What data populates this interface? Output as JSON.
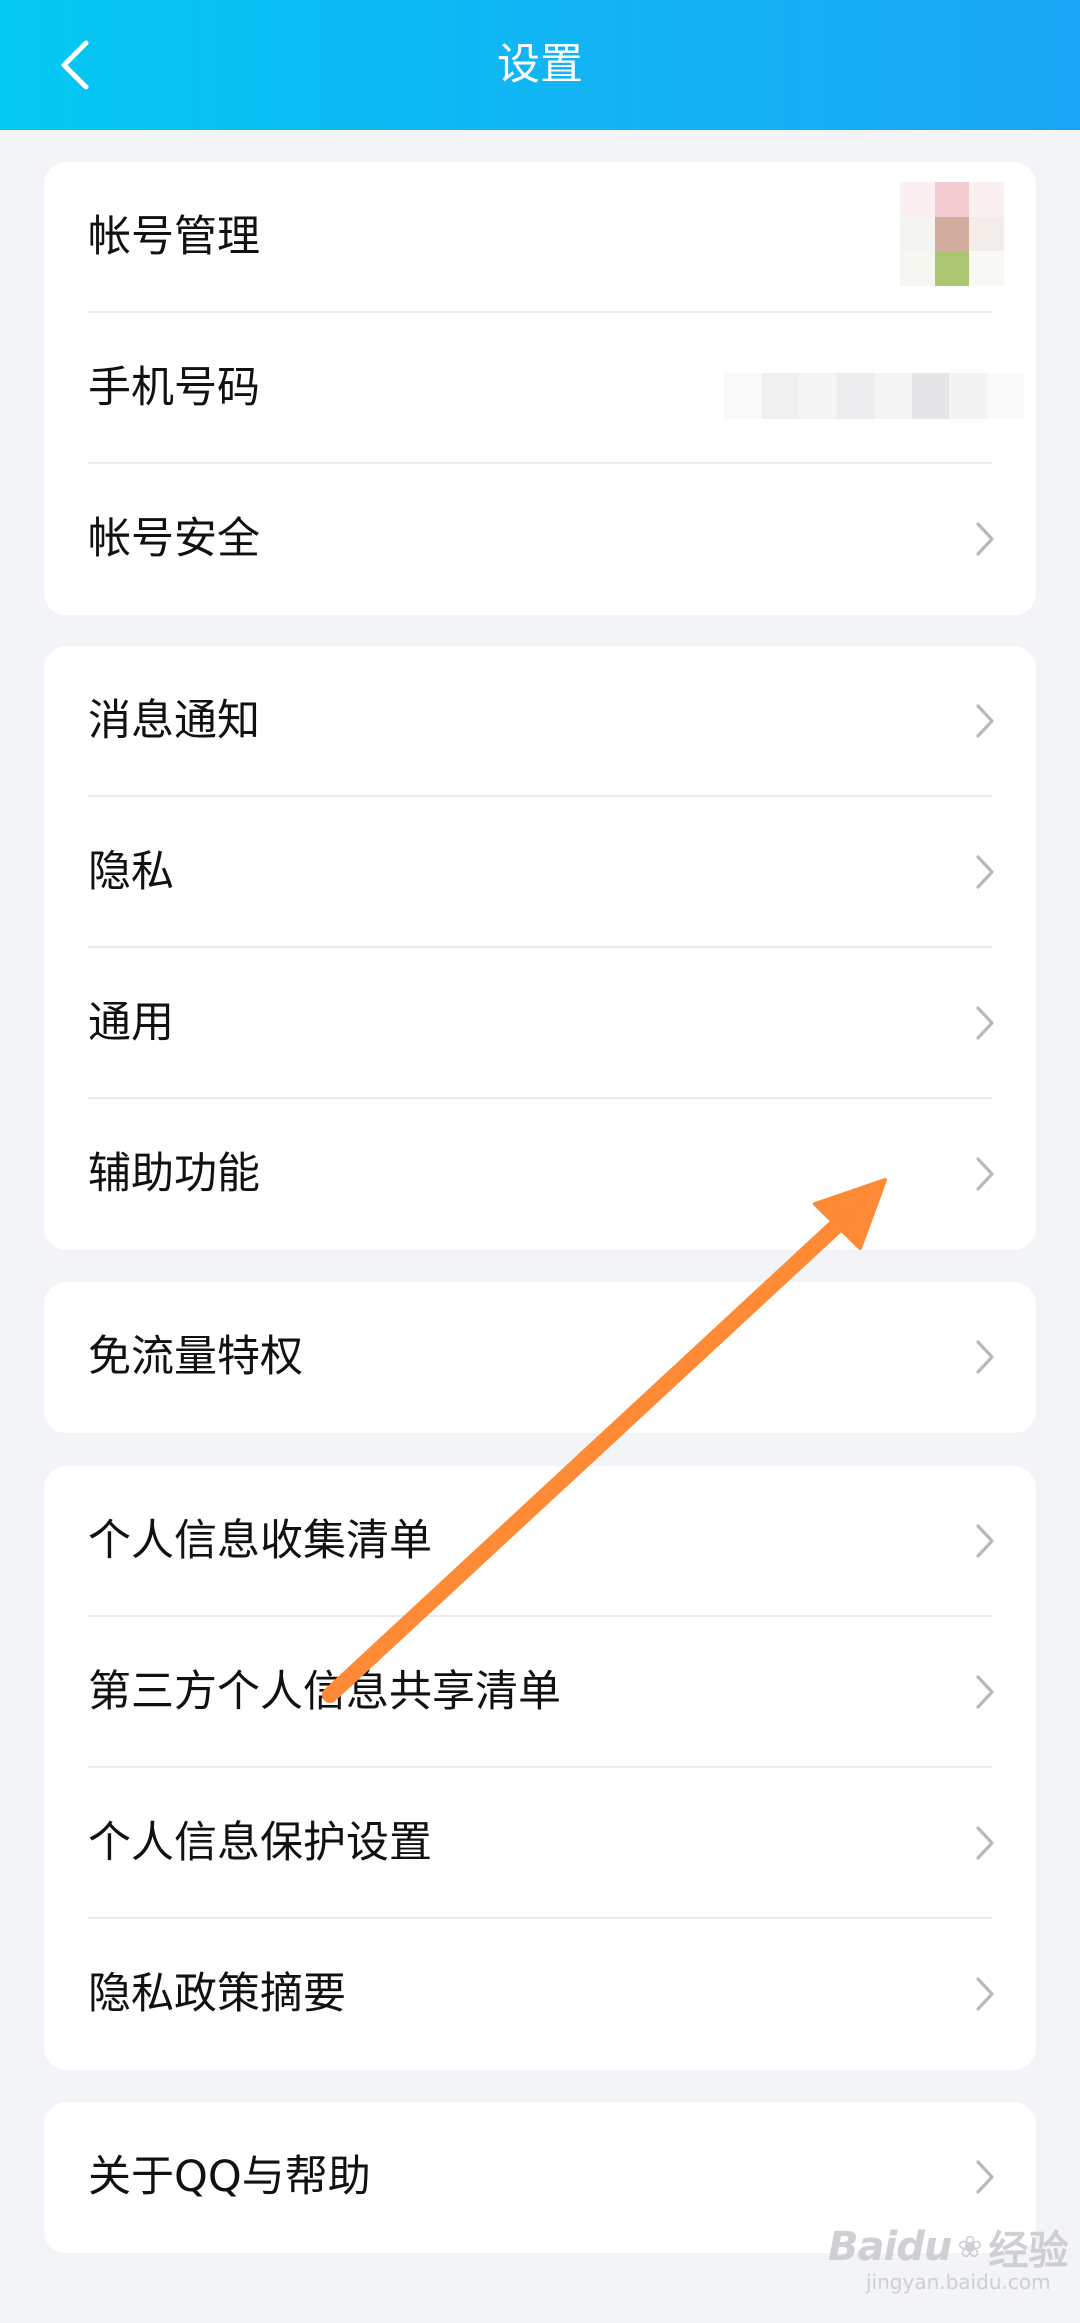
{
  "header": {
    "title": "设置",
    "back_icon": "chevron-left-icon"
  },
  "groups": [
    {
      "items": [
        {
          "label": "帐号管理",
          "chevron": false,
          "extra": "avatar"
        },
        {
          "label": "手机号码",
          "chevron": false,
          "extra": "phone-value"
        },
        {
          "label": "帐号安全",
          "chevron": true
        }
      ]
    },
    {
      "items": [
        {
          "label": "消息通知",
          "chevron": true
        },
        {
          "label": "隐私",
          "chevron": true
        },
        {
          "label": "通用",
          "chevron": true
        },
        {
          "label": "辅助功能",
          "chevron": true
        }
      ]
    },
    {
      "items": [
        {
          "label": "免流量特权",
          "chevron": true
        }
      ]
    },
    {
      "items": [
        {
          "label": "个人信息收集清单",
          "chevron": true
        },
        {
          "label": "第三方个人信息共享清单",
          "chevron": true
        },
        {
          "label": "个人信息保护设置",
          "chevron": true
        },
        {
          "label": "隐私政策摘要",
          "chevron": true
        }
      ]
    },
    {
      "items": [
        {
          "label": "关于QQ与帮助",
          "chevron": true
        }
      ]
    }
  ],
  "watermark": {
    "brand": "Baidu",
    "suffix": "经验",
    "url": "jingyan.baidu.com"
  },
  "colors": {
    "header_start": "#04C8F2",
    "header_end": "#1AA6F4",
    "background": "#F2F4F8",
    "annotation_arrow": "#FF8A35",
    "chevron": "#B8B9BE"
  },
  "icons": {
    "chevron": "chevron-right-icon",
    "annotation": "annotation-arrow"
  }
}
